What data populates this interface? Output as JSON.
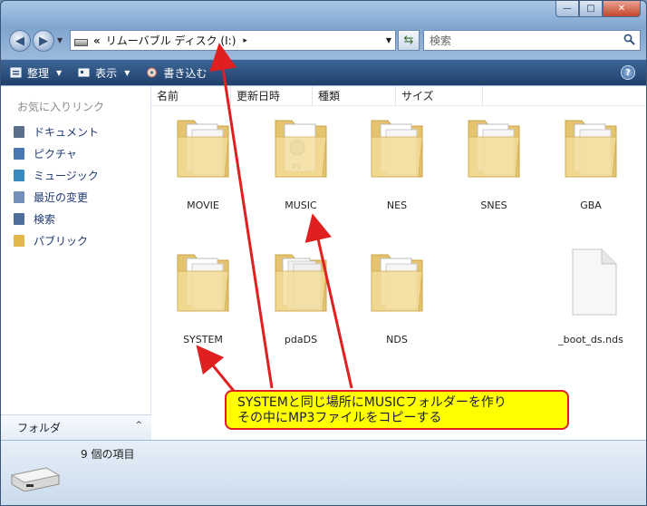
{
  "window": {
    "caption": {
      "minimize": "—",
      "maximize": "□",
      "close": "✕"
    }
  },
  "nav": {
    "back_icon": "arrow-left-icon",
    "forward_icon": "arrow-right-icon",
    "address_prefix": "«",
    "address_text": "リムーバブル ディスク (I:)",
    "address_arrow": "▸",
    "search_placeholder": "検索"
  },
  "toolbar": {
    "organize": "整理",
    "views": "表示",
    "burn": "書き込む",
    "help": "?"
  },
  "sidebar": {
    "favorites_header": "お気に入りリンク",
    "items": [
      {
        "label": "ドキュメント",
        "color": "#5b6f8a"
      },
      {
        "label": "ピクチャ",
        "color": "#4a77b0"
      },
      {
        "label": "ミュージック",
        "color": "#3a8ac0"
      },
      {
        "label": "最近の変更",
        "color": "#7490b8"
      },
      {
        "label": "検索",
        "color": "#4f6f9a"
      },
      {
        "label": "パブリック",
        "color": "#e2b84a"
      }
    ],
    "folders_label": "フォルダ",
    "folders_caret": "^"
  },
  "columns": [
    "名前",
    "更新日時",
    "種類",
    "サイズ"
  ],
  "files": [
    {
      "name": "MOVIE",
      "type": "folder"
    },
    {
      "name": "MUSIC",
      "type": "folder-music"
    },
    {
      "name": "NES",
      "type": "folder"
    },
    {
      "name": "SNES",
      "type": "folder"
    },
    {
      "name": "GBA",
      "type": "folder"
    },
    {
      "name": "SYSTEM",
      "type": "folder"
    },
    {
      "name": "pdaDS",
      "type": "folder-full"
    },
    {
      "name": "NDS",
      "type": "folder"
    },
    {
      "name": "_boot_ds.nds",
      "type": "file"
    }
  ],
  "status": {
    "count": "9 個の項目"
  },
  "annotation": {
    "line1": "SYSTEMと同じ場所にMUSICフォルダーを作り",
    "line2": "その中にMP3ファイルをコピーする",
    "color": "#e02020"
  }
}
